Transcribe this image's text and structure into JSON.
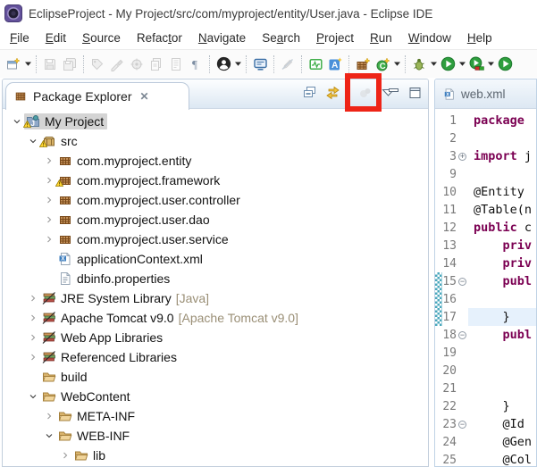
{
  "window": {
    "title": "EclipseProject - My Project/src/com/myproject/entity/User.java - Eclipse IDE"
  },
  "menu": {
    "items": [
      {
        "label": "File",
        "mnemonic": 0
      },
      {
        "label": "Edit",
        "mnemonic": 0
      },
      {
        "label": "Source",
        "mnemonic": 0
      },
      {
        "label": "Refactor",
        "mnemonic": 5
      },
      {
        "label": "Navigate",
        "mnemonic": 0
      },
      {
        "label": "Search",
        "mnemonic": 2
      },
      {
        "label": "Project",
        "mnemonic": 0
      },
      {
        "label": "Run",
        "mnemonic": 0
      },
      {
        "label": "Window",
        "mnemonic": 0
      },
      {
        "label": "Help",
        "mnemonic": 0
      }
    ]
  },
  "toolbar": {
    "groups": [
      {
        "items": [
          {
            "icon": "new-wizard-icon",
            "caret": true
          }
        ]
      },
      {
        "items": [
          {
            "icon": "save-icon",
            "disabled": true
          },
          {
            "icon": "save-all-icon",
            "disabled": true
          }
        ]
      },
      {
        "items": [
          {
            "icon": "pin-icon",
            "disabled": true
          },
          {
            "icon": "brush-icon",
            "disabled": true
          },
          {
            "icon": "build-icon",
            "disabled": true
          },
          {
            "icon": "copy-icon",
            "disabled": true
          },
          {
            "icon": "document-icon",
            "disabled": true
          },
          {
            "icon": "pilcrow-icon"
          }
        ]
      },
      {
        "items": [
          {
            "icon": "user-avatar-icon",
            "caret": true
          }
        ]
      },
      {
        "items": [
          {
            "icon": "console-icon"
          }
        ]
      },
      {
        "items": [
          {
            "icon": "pen-slash-icon",
            "disabled": true
          }
        ]
      },
      {
        "items": [
          {
            "icon": "activity-icon"
          },
          {
            "icon": "annotation-a-icon"
          }
        ]
      },
      {
        "items": [
          {
            "icon": "new-package-icon"
          },
          {
            "icon": "new-class-icon",
            "caret": true
          }
        ]
      },
      {
        "items": [
          {
            "icon": "debug-icon",
            "caret": true
          },
          {
            "icon": "run-icon",
            "caret": true
          },
          {
            "icon": "coverage-icon",
            "caret": true
          },
          {
            "icon": "profile-icon"
          }
        ]
      }
    ]
  },
  "package_explorer": {
    "tab_label": "Package Explorer",
    "close_glyph": "✕",
    "toolbar": [
      {
        "icon": "collapse-all-icon"
      },
      {
        "icon": "link-editor-icon"
      },
      {
        "sep": true
      },
      {
        "icon": "focus-icon",
        "disabled": true
      },
      {
        "icon": "view-menu-icon",
        "highlighted": true
      }
    ],
    "window_buttons": [
      {
        "icon": "minimize-icon"
      },
      {
        "icon": "maximize-icon"
      }
    ],
    "tree": [
      {
        "label": "My Project",
        "icon": "java-project-icon",
        "warning": true,
        "expand": "open",
        "level": 0,
        "selected": true
      },
      {
        "label": "src",
        "icon": "src-folder-icon",
        "warning": true,
        "expand": "open",
        "level": 1
      },
      {
        "label": "com.myproject.entity",
        "icon": "package-icon",
        "expand": "closed",
        "level": 2
      },
      {
        "label": "com.myproject.framework",
        "icon": "package-icon",
        "warning": true,
        "expand": "closed",
        "level": 2
      },
      {
        "label": "com.myproject.user.controller",
        "icon": "package-icon",
        "expand": "closed",
        "level": 2
      },
      {
        "label": "com.myproject.user.dao",
        "icon": "package-icon",
        "expand": "closed",
        "level": 2
      },
      {
        "label": "com.myproject.user.service",
        "icon": "package-icon",
        "expand": "closed",
        "level": 2
      },
      {
        "label": "applicationContext.xml",
        "icon": "xml-file-icon",
        "level": 2
      },
      {
        "label": "dbinfo.properties",
        "icon": "properties-file-icon",
        "level": 2
      },
      {
        "label": "JRE System Library",
        "decoration": " [Java]",
        "icon": "library-icon",
        "expand": "closed",
        "level": 1
      },
      {
        "label": "Apache Tomcat v9.0",
        "decoration": " [Apache Tomcat v9.0]",
        "icon": "library-icon",
        "expand": "closed",
        "level": 1
      },
      {
        "label": "Web App Libraries",
        "icon": "library-icon",
        "expand": "closed",
        "level": 1
      },
      {
        "label": "Referenced Libraries",
        "icon": "library-icon",
        "expand": "closed",
        "level": 1
      },
      {
        "label": "build",
        "icon": "folder-icon",
        "level": 1
      },
      {
        "label": "WebContent",
        "icon": "folder-icon",
        "expand": "open",
        "level": 1
      },
      {
        "label": "META-INF",
        "icon": "folder-icon",
        "expand": "closed",
        "level": 2
      },
      {
        "label": "WEB-INF",
        "icon": "folder-icon",
        "expand": "open",
        "level": 2
      },
      {
        "label": "lib",
        "icon": "folder-icon",
        "expand": "closed",
        "level": 3
      }
    ]
  },
  "editor": {
    "tab_label": "web.xml",
    "lines": [
      {
        "n": "1",
        "seg": [
          [
            "package",
            "k"
          ]
        ]
      },
      {
        "n": "2"
      },
      {
        "n": "3",
        "fold": "+",
        "seg": [
          [
            "import",
            "k"
          ],
          [
            " j",
            ""
          ]
        ]
      },
      {
        "n": "9"
      },
      {
        "n": "10",
        "seg": [
          [
            "@Entity",
            ""
          ]
        ]
      },
      {
        "n": "11",
        "seg": [
          [
            "@Table(n",
            ""
          ]
        ]
      },
      {
        "n": "12",
        "seg": [
          [
            "public",
            "k"
          ],
          [
            " c",
            ""
          ]
        ]
      },
      {
        "n": "13",
        "seg": [
          [
            "    ",
            ""
          ],
          [
            "priv",
            "k"
          ]
        ]
      },
      {
        "n": "14",
        "seg": [
          [
            "    ",
            ""
          ],
          [
            "priv",
            "k"
          ]
        ]
      },
      {
        "n": "15",
        "fold": "-",
        "change": true,
        "seg": [
          [
            "    ",
            ""
          ],
          [
            "publ",
            "k"
          ]
        ]
      },
      {
        "n": "16",
        "change": true
      },
      {
        "n": "17",
        "change": true,
        "current": true,
        "seg": [
          [
            "    }",
            ""
          ]
        ]
      },
      {
        "n": "18",
        "fold": "-",
        "seg": [
          [
            "    ",
            ""
          ],
          [
            "publ",
            "k"
          ]
        ]
      },
      {
        "n": "19"
      },
      {
        "n": "20"
      },
      {
        "n": "21"
      },
      {
        "n": "22",
        "seg": [
          [
            "    }",
            ""
          ]
        ]
      },
      {
        "n": "23",
        "fold": "-",
        "seg": [
          [
            "    @Id",
            ""
          ]
        ]
      },
      {
        "n": "24",
        "seg": [
          [
            "    @Gen",
            ""
          ]
        ]
      },
      {
        "n": "25",
        "seg": [
          [
            "    @Col",
            ""
          ]
        ]
      }
    ]
  },
  "colors": {
    "keyword": "#7b0052",
    "line_number": "#7a7a7a",
    "current_line": "#e6f1fc",
    "change_bar": "#4aa7bc",
    "selection": "#d4d4d4",
    "highlight_rectangle": "#ee2417",
    "decoration_text": "#9a8f76"
  }
}
